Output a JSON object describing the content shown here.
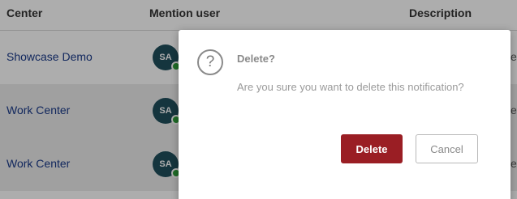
{
  "table": {
    "headers": {
      "center": "Center",
      "mention_user": "Mention user",
      "description": "Description"
    },
    "rows": [
      {
        "center": "Showcase Demo",
        "avatar_initials": "SA",
        "description_peek": "e"
      },
      {
        "center": "Work Center",
        "avatar_initials": "SA",
        "description_peek": "e"
      },
      {
        "center": "Work Center",
        "avatar_initials": "SA",
        "description_peek": "e"
      }
    ]
  },
  "dialog": {
    "icon": "question-circle-icon",
    "title": "Delete?",
    "message": "Are you sure you want to delete this notification?",
    "delete_label": "Delete",
    "cancel_label": "Cancel"
  },
  "colors": {
    "link": "#1a3a8a",
    "avatar_bg": "#1f4e5c",
    "online_status": "#2e9e3a",
    "delete_button": "#9a1e24"
  }
}
